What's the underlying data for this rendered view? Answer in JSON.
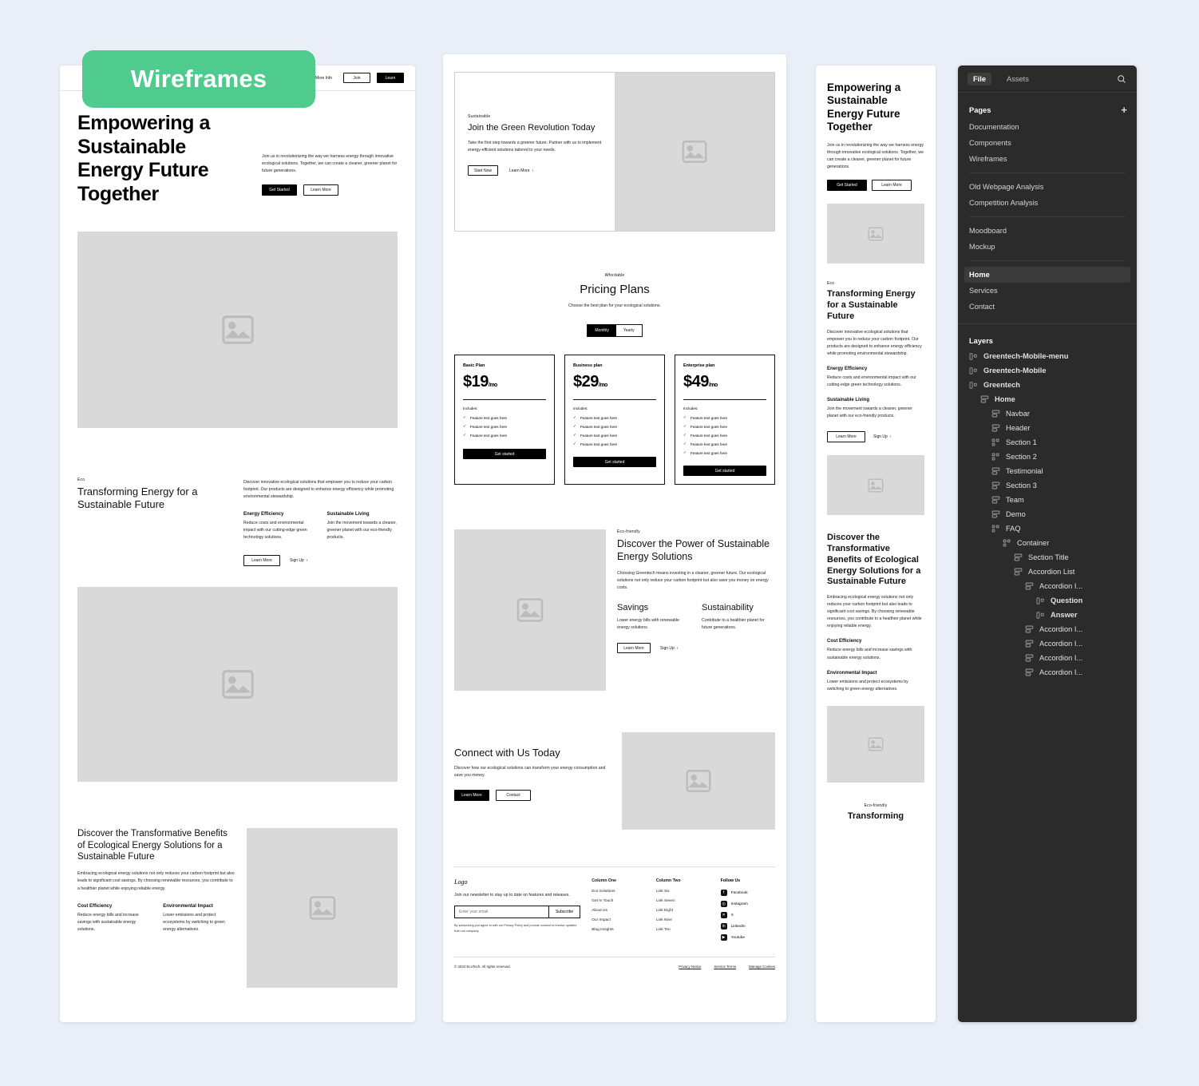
{
  "badge": {
    "label": "Wireframes"
  },
  "wireframe1": {
    "nav": {
      "link": "More Info",
      "join": "Join",
      "learn": "Learn"
    },
    "hero": {
      "title": "Empowering a Sustainable Energy Future Together",
      "body": "Join us in revolutionizing the way we harness energy through innovative ecological solutions. Together, we can create a cleaner, greener planet for future generations.",
      "primary": "Get Started",
      "secondary": "Learn More"
    },
    "section2": {
      "eyebrow": "Eco",
      "title": "Transforming Energy for a Sustainable Future",
      "body": "Discover innovative ecological solutions that empower you to reduce your carbon footprint. Our products are designed to enhance energy efficiency while promoting environmental stewardship.",
      "col1_title": "Energy Efficiency",
      "col1_body": "Reduce costs and environmental impact with our cutting-edge green technology solutions.",
      "col2_title": "Sustainable Living",
      "col2_body": "Join the movement towards a cleaner, greener planet with our eco-friendly products.",
      "primary": "Learn More",
      "secondary": "Sign Up"
    },
    "section3": {
      "title": "Discover the Transformative Benefits of Ecological Energy Solutions for a Sustainable Future",
      "body": "Embracing ecological energy solutions not only reduces your carbon footprint but also leads to significant cost savings. By choosing renewable resources, you contribute to a healthier planet while enjoying reliable energy.",
      "col1_title": "Cost Efficiency",
      "col1_body": "Reduce energy bills and increase savings with sustainable energy solutions.",
      "col2_title": "Environmental Impact",
      "col2_body": "Lower emissions and protect ecosystems by switching to green energy alternatives."
    }
  },
  "wireframe2": {
    "hero": {
      "eyebrow": "Sustainable",
      "title": "Join the Green Revolution Today",
      "body": "Take the first step towards a greener future. Partner with us to implement energy-efficient solutions tailored to your needs.",
      "primary": "Start Now",
      "secondary": "Learn More"
    },
    "pricing": {
      "eyebrow": "Affordable",
      "title": "Pricing Plans",
      "subtitle": "Choose the best plan for your ecological solutions.",
      "toggle_monthly": "Monthly",
      "toggle_yearly": "Yearly",
      "includes_label": "Includes:",
      "cta": "Get started",
      "plans": [
        {
          "name": "Basic Plan",
          "price": "$19",
          "period": "/mo",
          "features": [
            "Feature text goes here",
            "Feature text goes here",
            "Feature text goes here"
          ]
        },
        {
          "name": "Business plan",
          "price": "$29",
          "period": "/mo",
          "features": [
            "Feature text goes here",
            "Feature text goes here",
            "Feature text goes here",
            "Feature text goes here"
          ]
        },
        {
          "name": "Enterprise plan",
          "price": "$49",
          "period": "/mo",
          "features": [
            "Feature text goes here",
            "Feature text goes here",
            "Feature text goes here",
            "Feature text goes here",
            "Feature text goes here"
          ]
        }
      ]
    },
    "discover": {
      "eyebrow": "Eco-friendly",
      "title": "Discover the Power of Sustainable Energy Solutions",
      "body": "Choosing Greentech means investing in a cleaner, greener future. Our ecological solutions not only reduce your carbon footprint but also save you money on energy costs.",
      "col1_title": "Savings",
      "col1_body": "Lower energy bills with renewable energy solutions.",
      "col2_title": "Sustainability",
      "col2_body": "Contribute to a healthier planet for future generations.",
      "primary": "Learn More",
      "secondary": "Sign Up"
    },
    "cta": {
      "title": "Connect with Us Today",
      "body": "Discover how our ecological solutions can transform your energy consumption and save you money.",
      "primary": "Learn More",
      "secondary": "Contact"
    },
    "footer": {
      "logo": "Logo",
      "newsletter_text": "Join our newsletter to stay up to date on features and releases.",
      "email_placeholder": "Enter your email",
      "subscribe": "Subscribe",
      "fine_print": "By subscribing you agree to with our Privacy Policy and provide consent to receive updates from our company.",
      "column_one_title": "Column One",
      "column_one": [
        "Eco Solutions",
        "Get In Touch",
        "About Us",
        "Our Impact",
        "Blog Insights"
      ],
      "column_two_title": "Column Two",
      "column_two": [
        "Link Six",
        "Link Seven",
        "Link Eight",
        "Link Nine",
        "Link Ten"
      ],
      "follow_title": "Follow Us",
      "socials": [
        {
          "name": "Facebook",
          "glyph": "f"
        },
        {
          "name": "Instagram",
          "glyph": "◎"
        },
        {
          "name": "X",
          "glyph": "✕"
        },
        {
          "name": "LinkedIn",
          "glyph": "in"
        },
        {
          "name": "Youtube",
          "glyph": "▶"
        }
      ],
      "copyright": "© 2024 EcoTech. All rights reserved.",
      "legal": [
        "Privacy Notice",
        "Service Terms",
        "Manage Cookies"
      ]
    }
  },
  "wireframe3": {
    "hero": {
      "title": "Empowering a Sustainable Energy Future Together",
      "body": "Join us in revolutionizing the way we harness energy through innovative ecological solutions. Together, we can create a cleaner, greener planet for future generations.",
      "primary": "Get Started",
      "secondary": "Learn More"
    },
    "section2": {
      "eyebrow": "Eco",
      "title": "Transforming Energy for a Sustainable Future",
      "body": "Discover innovative ecological solutions that empower you to reduce your carbon footprint. Our products are designed to enhance energy efficiency while promoting environmental stewardship.",
      "col1_title": "Energy Efficiency",
      "col1_body": "Reduce costs and environmental impact with our cutting-edge green technology solutions.",
      "col2_title": "Sustainable Living",
      "col2_body": "Join the movement towards a cleaner, greener planet with our eco-friendly products.",
      "primary": "Learn More",
      "secondary": "Sign Up"
    },
    "section3": {
      "title": "Discover the Transformative Benefits of Ecological Energy Solutions for a Sustainable Future",
      "body": "Embracing ecological energy solutions not only reduces your carbon footprint but also leads to significant cost savings. By choosing renewable resources, you contribute to a healthier planet while enjoying reliable energy.",
      "col1_title": "Cost Efficiency",
      "col1_body": "Reduce energy bills and increase savings with sustainable energy solutions.",
      "col2_title": "Environmental Impact",
      "col2_body": "Lower emissions and protect ecosystems by switching to green energy alternatives."
    },
    "section4": {
      "eyebrow": "Eco-friendly",
      "title": "Transforming"
    }
  },
  "panel": {
    "tabs": {
      "file": "File",
      "assets": "Assets"
    },
    "pages_title": "Pages",
    "pages": [
      "Documentation",
      "Components",
      "Wireframes"
    ],
    "analysis": [
      "Old Webpage Analysis",
      "Competition Analysis"
    ],
    "design": [
      "Moodboard",
      "Mockup"
    ],
    "site": [
      "Home",
      "Services",
      "Contact"
    ],
    "selected_page": "Home",
    "layers_title": "Layers",
    "layers": [
      {
        "label": "Greentech-Mobile-menu",
        "depth": 0,
        "icon": "component-icon",
        "bold": true
      },
      {
        "label": "Greentech-Mobile",
        "depth": 0,
        "icon": "component-icon",
        "bold": true
      },
      {
        "label": "Greentech",
        "depth": 0,
        "icon": "component-icon",
        "bold": true
      },
      {
        "label": "Home",
        "depth": 1,
        "icon": "frame-icon",
        "bold": true
      },
      {
        "label": "Navbar",
        "depth": 2,
        "icon": "frame-icon",
        "bold": false
      },
      {
        "label": "Header",
        "depth": 2,
        "icon": "frame-icon",
        "bold": false
      },
      {
        "label": "Section 1",
        "depth": 2,
        "icon": "group-icon",
        "bold": false
      },
      {
        "label": "Section 2",
        "depth": 2,
        "icon": "group-icon",
        "bold": false
      },
      {
        "label": "Testimonial",
        "depth": 2,
        "icon": "frame-icon",
        "bold": false
      },
      {
        "label": "Section 3",
        "depth": 2,
        "icon": "frame-icon",
        "bold": false
      },
      {
        "label": "Team",
        "depth": 2,
        "icon": "frame-icon",
        "bold": false
      },
      {
        "label": "Demo",
        "depth": 2,
        "icon": "frame-icon",
        "bold": false
      },
      {
        "label": "FAQ",
        "depth": 2,
        "icon": "group-icon",
        "bold": false
      },
      {
        "label": "Container",
        "depth": 3,
        "icon": "group-icon",
        "bold": false
      },
      {
        "label": "Section Title",
        "depth": 4,
        "icon": "frame-icon",
        "bold": false
      },
      {
        "label": "Accordion List",
        "depth": 4,
        "icon": "frame-icon",
        "bold": false
      },
      {
        "label": "Accordion I...",
        "depth": 5,
        "icon": "frame-icon",
        "bold": false
      },
      {
        "label": "Question",
        "depth": 6,
        "icon": "component-icon",
        "bold": true
      },
      {
        "label": "Answer",
        "depth": 6,
        "icon": "component-icon",
        "bold": true
      },
      {
        "label": "Accordion I...",
        "depth": 5,
        "icon": "frame-icon",
        "bold": false
      },
      {
        "label": "Accordion I...",
        "depth": 5,
        "icon": "frame-icon",
        "bold": false
      },
      {
        "label": "Accordion I...",
        "depth": 5,
        "icon": "frame-icon",
        "bold": false
      },
      {
        "label": "Accordion I...",
        "depth": 5,
        "icon": "frame-icon",
        "bold": false
      }
    ]
  },
  "colors": {
    "badge_green": "#4ecb8d",
    "panel_bg": "#2b2b2b",
    "page_bg": "#eaeff7",
    "placeholder": "#d9d9d9"
  }
}
